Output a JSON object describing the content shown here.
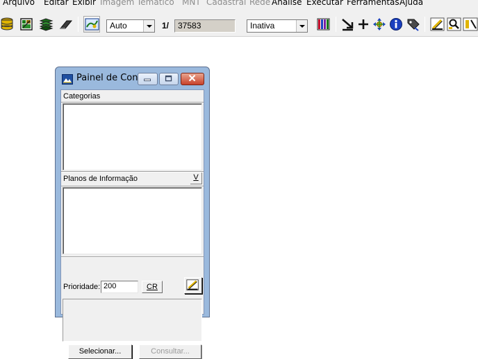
{
  "menu": {
    "items": [
      {
        "label": "Arquivo",
        "enabled": true
      },
      {
        "label": "Editar",
        "enabled": true
      },
      {
        "label": "Exibir",
        "enabled": true
      },
      {
        "label": "Imagem",
        "enabled": false
      },
      {
        "label": "Temático",
        "enabled": false
      },
      {
        "label": "MNT",
        "enabled": false
      },
      {
        "label": "Cadastral",
        "enabled": false
      },
      {
        "label": "Rede",
        "enabled": false
      },
      {
        "label": "Análise",
        "enabled": true
      },
      {
        "label": "Executar",
        "enabled": true
      },
      {
        "label": "Ferramentas",
        "enabled": true
      },
      {
        "label": "Ajuda",
        "enabled": true
      }
    ]
  },
  "toolbar": {
    "zoom_mode": "Auto",
    "scale_prefix": "1/",
    "scale_value": "37583",
    "state_select": "Inativa",
    "icons": [
      "database-icon",
      "image-layer-icon",
      "layers-icon",
      "eraser-icon",
      "map-view-icon",
      "palette-grid-icon",
      "arrow-down-right-icon",
      "crosshair-icon",
      "pan-icon",
      "info-icon",
      "tag-icon",
      "pencil-icon",
      "zoom-tool-icon"
    ]
  },
  "panel": {
    "title": "Painel de Con...",
    "categories_label": "Categorias",
    "planes_label": "Planos de Informação",
    "v_button": "V",
    "priority_label": "Prioridade:",
    "priority_value": "200",
    "cr_button": "CR",
    "select_button": "Selecionar...",
    "query_button": "Consultar..."
  },
  "colors": {
    "window_frame": "#9ab9dd",
    "close_button": "#c8412a",
    "dialog_bg": "#f0f0f0"
  }
}
